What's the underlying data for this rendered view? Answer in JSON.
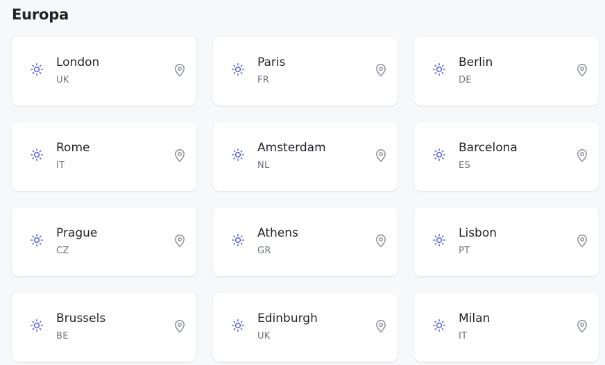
{
  "section": {
    "title": "Europa"
  },
  "accent_color": "#4f5fd6",
  "icons": {
    "weather": "sun-icon",
    "location": "map-pin-icon"
  },
  "cities": [
    {
      "name": "London",
      "country": "UK"
    },
    {
      "name": "Paris",
      "country": "FR"
    },
    {
      "name": "Berlin",
      "country": "DE"
    },
    {
      "name": "Rome",
      "country": "IT"
    },
    {
      "name": "Amsterdam",
      "country": "NL"
    },
    {
      "name": "Barcelona",
      "country": "ES"
    },
    {
      "name": "Prague",
      "country": "CZ"
    },
    {
      "name": "Athens",
      "country": "GR"
    },
    {
      "name": "Lisbon",
      "country": "PT"
    },
    {
      "name": "Brussels",
      "country": "BE"
    },
    {
      "name": "Edinburgh",
      "country": "UK"
    },
    {
      "name": "Milan",
      "country": "IT"
    }
  ]
}
